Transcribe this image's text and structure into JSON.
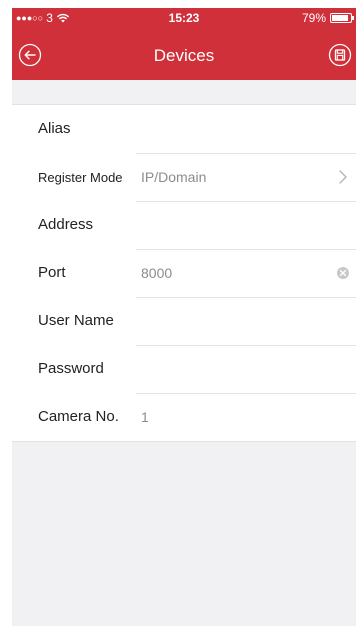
{
  "status_bar": {
    "signal_dots": "●●●○○",
    "carrier": "3",
    "time": "15:23",
    "battery_percent": "79%",
    "battery_level": 0.79,
    "wifi_icon": "wifi-icon"
  },
  "header": {
    "title": "Devices",
    "back_icon": "back-circle-icon",
    "save_icon": "save-icon",
    "background_color": "#d0303a"
  },
  "form": {
    "fields": [
      {
        "label": "Alias",
        "value": ""
      },
      {
        "label": "Register Mode",
        "value": "IP/Domain"
      },
      {
        "label": "Address",
        "value": ""
      },
      {
        "label": "Port",
        "value": "8000"
      },
      {
        "label": "User Name",
        "value": ""
      },
      {
        "label": "Password",
        "value": ""
      },
      {
        "label": "Camera No.",
        "value": "1"
      }
    ]
  }
}
